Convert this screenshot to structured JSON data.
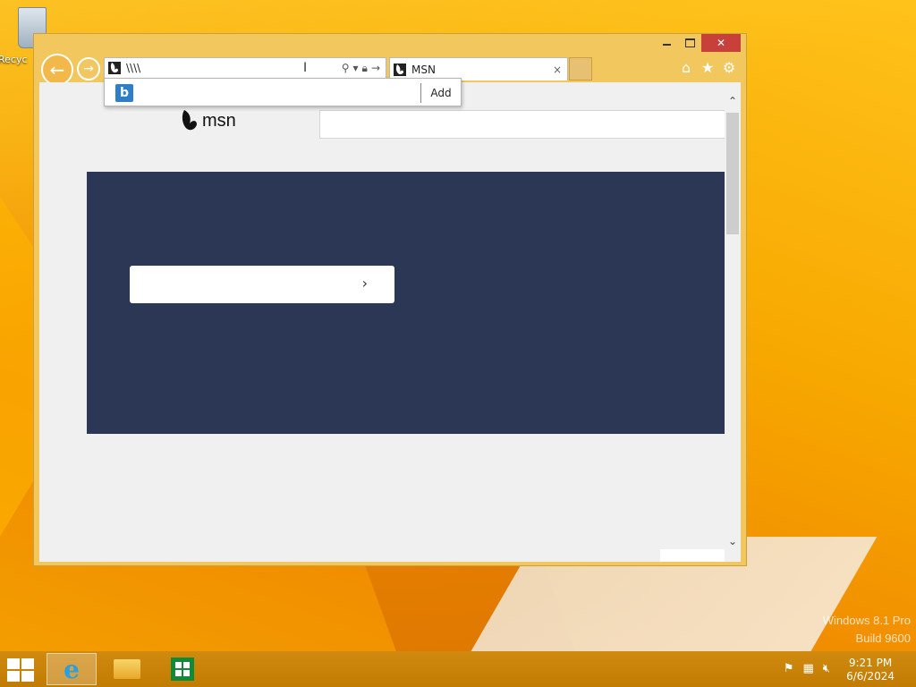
{
  "desktop": {
    "recycle_bin_label": "Recyc",
    "watermark_line1": "Windows 8.1 Pro",
    "watermark_line2": "Build 9600"
  },
  "browser": {
    "address_value": "\\\\\\\\",
    "address_favicon": "msn-favicon",
    "tab_title": "MSN",
    "tab_close": "×",
    "window_close": "✕",
    "back": "←",
    "forward": "→",
    "icons": [
      "home-icon",
      "favorites-star-icon",
      "settings-gear-icon"
    ]
  },
  "dropdown": {
    "add_label": "Add",
    "provider_icon": "b"
  },
  "page": {
    "logo_text": "msn",
    "cta_chevron": "›"
  },
  "taskbar": {
    "time": "9:21 PM",
    "date": "6/6/2024"
  },
  "colors": {
    "hero": "#2b3755",
    "window_frame": "#f2c85e",
    "close_button": "#c7403a",
    "taskbar": "#c17c00"
  }
}
